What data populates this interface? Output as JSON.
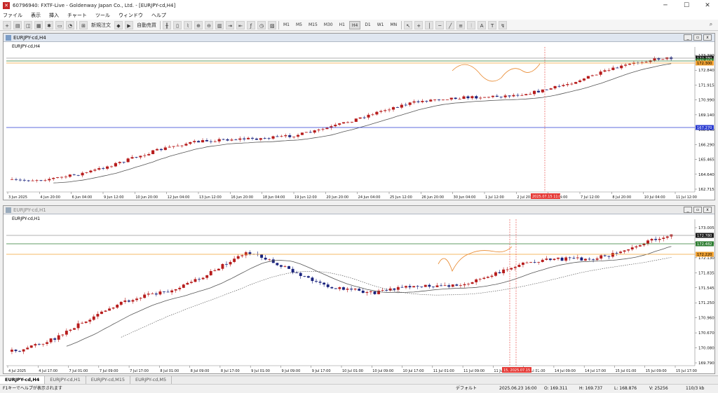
{
  "window": {
    "title": "60796940: FXTF-Live - Goldenway Japan Co., Ltd. - [EURJPY-cd,H4]"
  },
  "menu": [
    "ファイル",
    "表示",
    "挿入",
    "チャート",
    "ツール",
    "ウィンドウ",
    "ヘルプ"
  ],
  "toolbar": {
    "new_order": "新規注文",
    "auto_trading": "自動売買",
    "timeframes": [
      "M1",
      "M5",
      "M15",
      "M30",
      "H1",
      "H4",
      "D1",
      "W1",
      "MN"
    ],
    "active_timeframe": "H4"
  },
  "charts": {
    "top": {
      "window_title": "EURJPY-cd,H4",
      "symbol_label": "EURJPY-cd,H4",
      "price_ticks": [
        "173.390",
        "172.840",
        "171.915",
        "170.990",
        "169.140",
        "168.240",
        "166.290",
        "165.465",
        "164.640",
        "162.715"
      ],
      "price_tags": [
        {
          "label": "172.780",
          "bg": "#1a1a1a",
          "fg": "#ffffff"
        },
        {
          "label": "172.457",
          "bg": "#2e7d32",
          "fg": "#ffffff"
        },
        {
          "label": "172.300",
          "bg": "#f0a030",
          "fg": "#000000"
        },
        {
          "label": "167.270",
          "bg": "#2a3bd1",
          "fg": "#ffffff"
        }
      ],
      "time_ticks": [
        "3 Jun 2025",
        "4 Jun 20:00",
        "6 Jun 04:00",
        "9 Jun 12:00",
        "10 Jun 20:00",
        "12 Jun 04:00",
        "13 Jun 12:00",
        "16 Jun 20:00",
        "18 Jun 04:00",
        "19 Jun 12:00",
        "20 Jun 20:00",
        "24 Jun 04:00",
        "25 Jun 12:00",
        "26 Jun 20:00",
        "30 Jun 04:00",
        "1 Jul 12:00",
        "2 Jul 20:00",
        "4 Jul 04:00",
        "7 Jul 12:00",
        "8 Jul 20:00",
        "10 Jul 04:00",
        "11 Jul 12:00"
      ],
      "cursor_time": "2025.07.15 11:00"
    },
    "bottom": {
      "window_title": "EURJPY-cd,H1",
      "symbol_label": "EURJPY-cd,H1",
      "price_ticks": [
        "173.005",
        "172.425",
        "172.130",
        "171.835",
        "171.545",
        "171.250",
        "170.960",
        "170.670",
        "170.080",
        "169.790"
      ],
      "price_tags": [
        {
          "label": "172.780",
          "bg": "#1a1a1a",
          "fg": "#ffffff"
        },
        {
          "label": "172.482",
          "bg": "#2e7d32",
          "fg": "#ffffff"
        },
        {
          "label": "172.220",
          "bg": "#f0a030",
          "fg": "#000000"
        }
      ],
      "time_ticks": [
        "4 Jul 2025",
        "4 Jul 17:00",
        "7 Jul 01:00",
        "7 Jul 09:00",
        "7 Jul 17:00",
        "8 Jul 01:00",
        "8 Jul 09:00",
        "8 Jul 17:00",
        "9 Jul 01:00",
        "9 Jul 09:00",
        "9 Jul 17:00",
        "10 Jul 01:00",
        "10 Jul 09:00",
        "10 Jul 17:00",
        "11 Jul 01:00",
        "11 Jul 09:00",
        "11 Jul 17:00",
        "14 Jul 01:00",
        "14 Jul 09:00",
        "14 Jul 17:00",
        "15 Jul 01:00",
        "15 Jul 09:00",
        "15 Jul 17:00"
      ],
      "cursor_time": "15, 2025.07.15 16:00"
    }
  },
  "tabs": [
    "EURJPY-cd,H4",
    "EURJPY-cd,H1",
    "EURJPY-cd,M15",
    "EURJPY-cd,M5"
  ],
  "active_tab": "EURJPY-cd,H4",
  "status": {
    "help": "F1キーでヘルプが表示されます",
    "profile": "デフォルト",
    "time": "2025.06.23 16:00",
    "open": "O: 169.311",
    "high": "H: 169.737",
    "low": "L: 168.876",
    "volume": "V: 25256",
    "traffic": "110/3 kb"
  },
  "colors": {
    "bull_candle": "#b71c1c",
    "bear_candle": "#1a237e",
    "ma_line": "#555555",
    "horizontal_blue": "#2a3bd1",
    "horizontal_orange": "#f0a030",
    "horizontal_green": "#2e7d32",
    "cursor_red": "#e53935"
  }
}
